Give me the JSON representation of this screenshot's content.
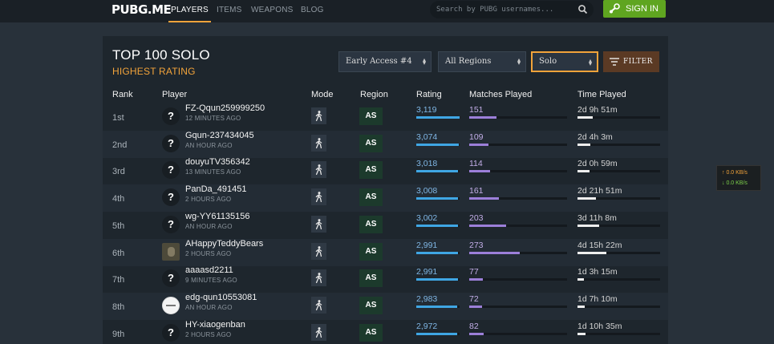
{
  "nav": {
    "logo": "PUBG.ME",
    "items": [
      {
        "label": "PLAYERS",
        "active": true
      },
      {
        "label": "ITEMS",
        "active": false
      },
      {
        "label": "WEAPONS",
        "active": false
      },
      {
        "label": "BLOG",
        "active": false
      }
    ],
    "search_placeholder": "Search by PUBG usernames...",
    "search_icon": "search-icon",
    "signin_label": "SIGN IN",
    "signin_icon": "steam-icon"
  },
  "leaderboard": {
    "title": "TOP 100 SOLO",
    "subtitle": "HIGHEST RATING",
    "filters": {
      "season": "Early Access #4",
      "region": "All Regions",
      "mode": "Solo",
      "button": "FILTER"
    },
    "columns": [
      "Rank",
      "Player",
      "Mode",
      "Region",
      "Rating",
      "Matches Played",
      "Time Played"
    ],
    "rows": [
      {
        "rank": "1st",
        "player": "FZ-Qqun259999250",
        "last_seen": "12 MINUTES AGO",
        "avatar": "placeholder",
        "region": "AS",
        "rating": "3,119",
        "rating_level": 1.0,
        "matches": "151",
        "matches_level": 0.28,
        "time": "2d 9h 51m",
        "time_level": 0.18
      },
      {
        "rank": "2nd",
        "player": "Gqun-237434045",
        "last_seen": "AN HOUR AGO",
        "avatar": "placeholder",
        "region": "AS",
        "rating": "3,074",
        "rating_level": 0.98,
        "matches": "109",
        "matches_level": 0.2,
        "time": "2d 4h 3m",
        "time_level": 0.16
      },
      {
        "rank": "3rd",
        "player": "douyuTV356342",
        "last_seen": "13 MINUTES AGO",
        "avatar": "placeholder",
        "region": "AS",
        "rating": "3,018",
        "rating_level": 0.97,
        "matches": "114",
        "matches_level": 0.21,
        "time": "2d 0h 59m",
        "time_level": 0.15
      },
      {
        "rank": "4th",
        "player": "PanDa_491451",
        "last_seen": "2 HOURS AGO",
        "avatar": "placeholder",
        "region": "AS",
        "rating": "3,008",
        "rating_level": 0.96,
        "matches": "161",
        "matches_level": 0.3,
        "time": "2d 21h 51m",
        "time_level": 0.22
      },
      {
        "rank": "5th",
        "player": "wg-YY61135156",
        "last_seen": "AN HOUR AGO",
        "avatar": "placeholder",
        "region": "AS",
        "rating": "3,002",
        "rating_level": 0.96,
        "matches": "203",
        "matches_level": 0.38,
        "time": "3d 11h 8m",
        "time_level": 0.26
      },
      {
        "rank": "6th",
        "player": "AHappyTeddyBears",
        "last_seen": "2 HOURS AGO",
        "avatar": "photo",
        "region": "AS",
        "rating": "2,991",
        "rating_level": 0.96,
        "matches": "273",
        "matches_level": 0.52,
        "time": "4d 15h 22m",
        "time_level": 0.35
      },
      {
        "rank": "7th",
        "player": "aaaasd2211",
        "last_seen": "9 MINUTES AGO",
        "avatar": "placeholder",
        "region": "AS",
        "rating": "2,991",
        "rating_level": 0.96,
        "matches": "77",
        "matches_level": 0.14,
        "time": "1d 3h 15m",
        "time_level": 0.08
      },
      {
        "rank": "8th",
        "player": "edg-qun10553081",
        "last_seen": "AN HOUR AGO",
        "avatar": "white",
        "region": "AS",
        "rating": "2,983",
        "rating_level": 0.95,
        "matches": "72",
        "matches_level": 0.13,
        "time": "1d 7h 10m",
        "time_level": 0.09
      },
      {
        "rank": "9th",
        "player": "HY-xiaogenban",
        "last_seen": "2 HOURS AGO",
        "avatar": "placeholder",
        "region": "AS",
        "rating": "2,972",
        "rating_level": 0.95,
        "matches": "82",
        "matches_level": 0.15,
        "time": "1d 10h 35m",
        "time_level": 0.1
      }
    ],
    "avatar_placeholder": "?",
    "mode_icon": "person-walking-icon"
  },
  "network": {
    "up": "0.0 KB/s",
    "down": "0.0 KB/s"
  },
  "colors": {
    "accent": "#f2a33a",
    "signin": "#5fa520",
    "rating": "#3fa6e4",
    "matches": "#9c7fd9",
    "region": "#1c3a2c"
  }
}
